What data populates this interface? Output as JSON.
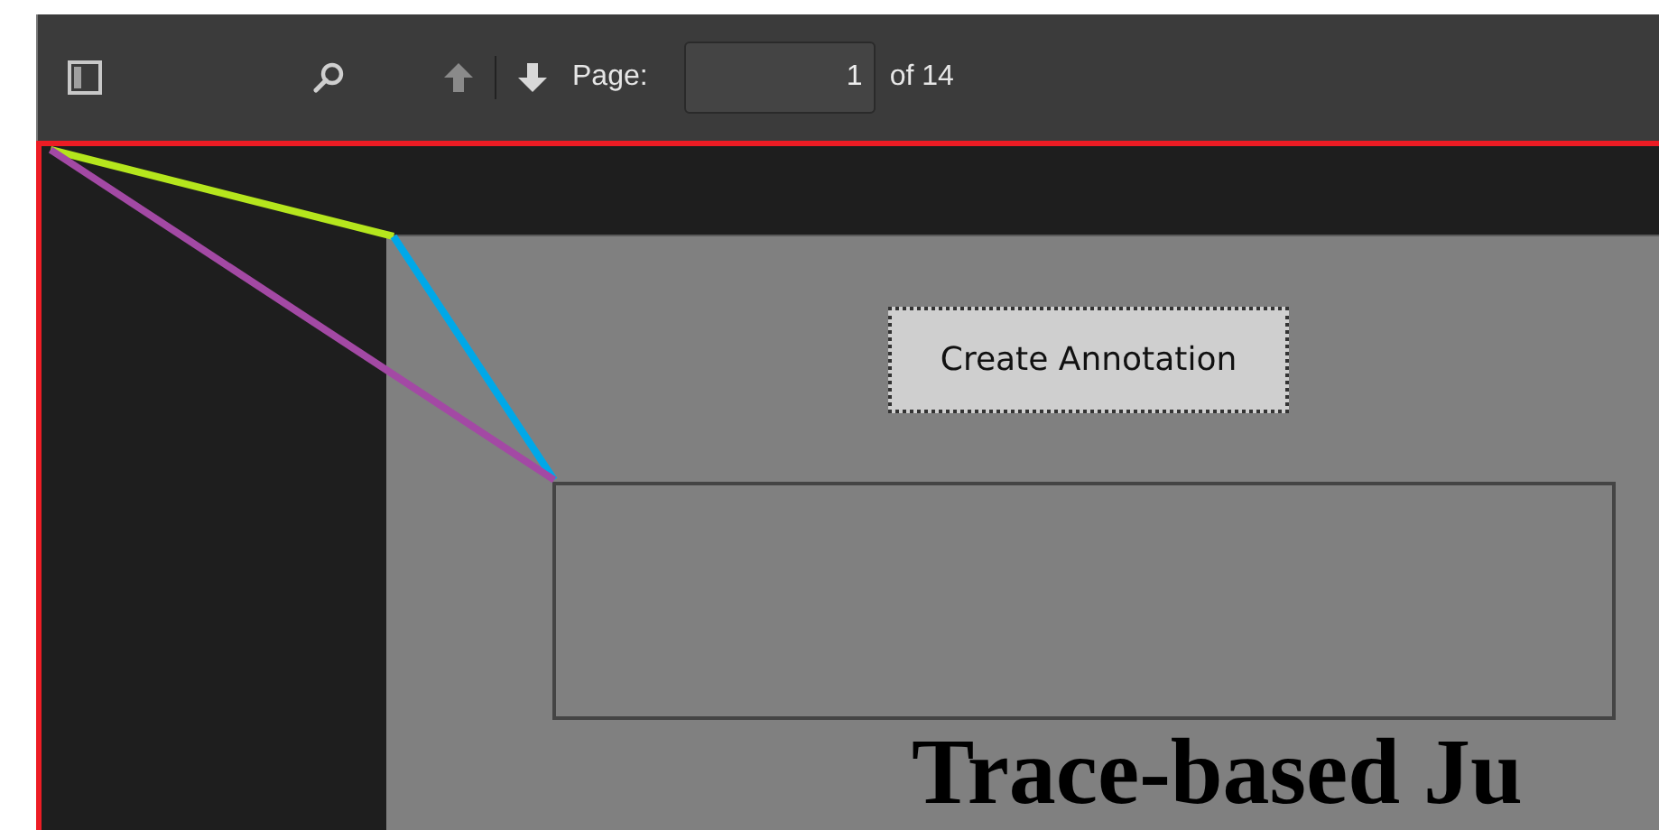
{
  "toolbar": {
    "page_label": "Page:",
    "page_input": "1",
    "page_total": "of 14"
  },
  "document": {
    "button": "Create Annotation",
    "title": "Trace-based Ju"
  }
}
